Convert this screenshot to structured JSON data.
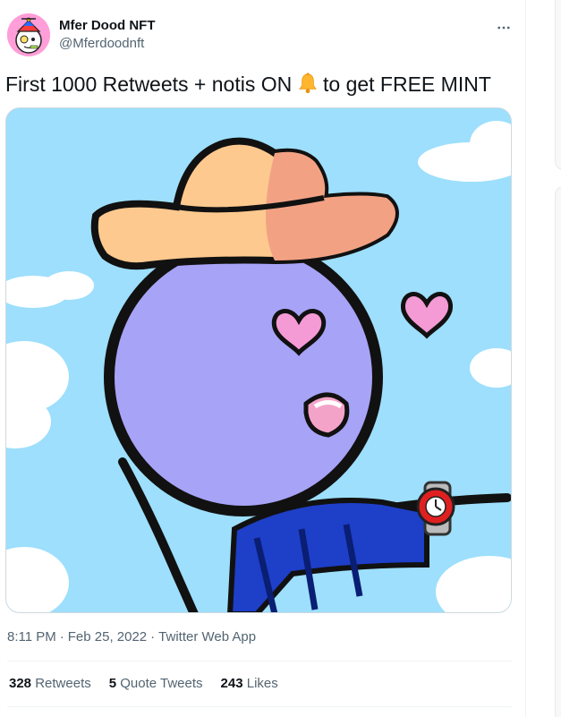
{
  "author": {
    "display_name": "Mfer Dood NFT",
    "handle": "@Mferdoodnft"
  },
  "tweet": {
    "text_before": "First 1000 Retweets + notis ON ",
    "emoji": "bell-icon",
    "text_after": " to get FREE MINT"
  },
  "meta": {
    "time": "8:11 PM",
    "separator": "·",
    "date": "Feb 25, 2022",
    "source": "Twitter Web App"
  },
  "stats": {
    "retweets": {
      "count": "328",
      "label": "Retweets"
    },
    "quote_tweets": {
      "count": "5",
      "label": "Quote Tweets"
    },
    "likes": {
      "count": "243",
      "label": "Likes"
    }
  },
  "colors": {
    "sky": "#9ddffc",
    "face": "#a7a3f7",
    "hat_light": "#fec98f",
    "hat_dark": "#f2a283",
    "heart": "#f49ad5",
    "scarf": "#1e3fc8",
    "watch": "#e02020",
    "secondary_text": "#536471"
  }
}
